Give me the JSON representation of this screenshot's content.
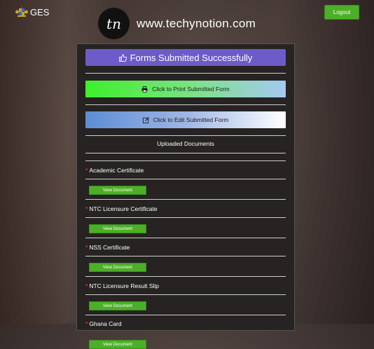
{
  "header": {
    "logo_text": "GES",
    "logout_label": "Logout"
  },
  "watermark": {
    "badge": "tn",
    "site": "www.techynotion.com"
  },
  "panel": {
    "success_label": "Forms Submitted Successfully",
    "print_label": "Click to Print Submitted Form",
    "edit_label": "Click to Edit Submitted Form",
    "uploaded_title": "Uploaded Documents",
    "documents": [
      {
        "label": "Academic Certificate",
        "button": "View Document"
      },
      {
        "label": "NTC Licensure Certificate",
        "button": "View Document"
      },
      {
        "label": "NSS Certificate",
        "button": "View Document"
      },
      {
        "label": "NTC Licensure Result Slip",
        "button": "View Document"
      },
      {
        "label": "Ghana Card",
        "button": "View Document"
      }
    ]
  },
  "colors": {
    "accent_green": "#4caf28",
    "success_purple": "#6d5bc8",
    "required_star": "#ff4444"
  }
}
